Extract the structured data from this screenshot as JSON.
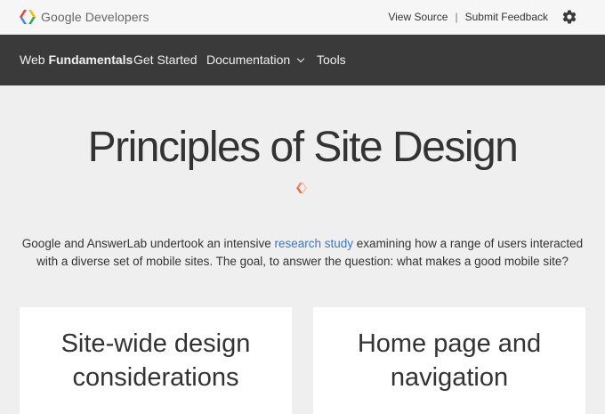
{
  "header": {
    "logo_text": "Google Developers",
    "links": [
      "View Source",
      "Submit Feedback"
    ],
    "separator": "|",
    "settings_icon": "gear-icon"
  },
  "nav": {
    "brand_prefix": "Web",
    "brand_bold": "Fundamentals",
    "items": [
      "Get Started",
      "Documentation",
      "Tools"
    ],
    "dropdown_icon": "chevron-down-icon"
  },
  "page": {
    "title": "Principles of Site Design",
    "intro_before": "Google and AnswerLab undertook an intensive ",
    "intro_link": "research study",
    "intro_after": " examining how a range of users interacted with a diverse set of mobile sites. The goal, to answer the question: what makes a good mobile site?"
  },
  "cards": [
    {
      "line1": "Site-wide design",
      "line2": "considerations"
    },
    {
      "line1": "Home page and",
      "line2": "navigation"
    }
  ],
  "colors": {
    "nav_bg": "#3a3a3a",
    "page_bg": "#efefef",
    "link": "#3b78c2"
  }
}
